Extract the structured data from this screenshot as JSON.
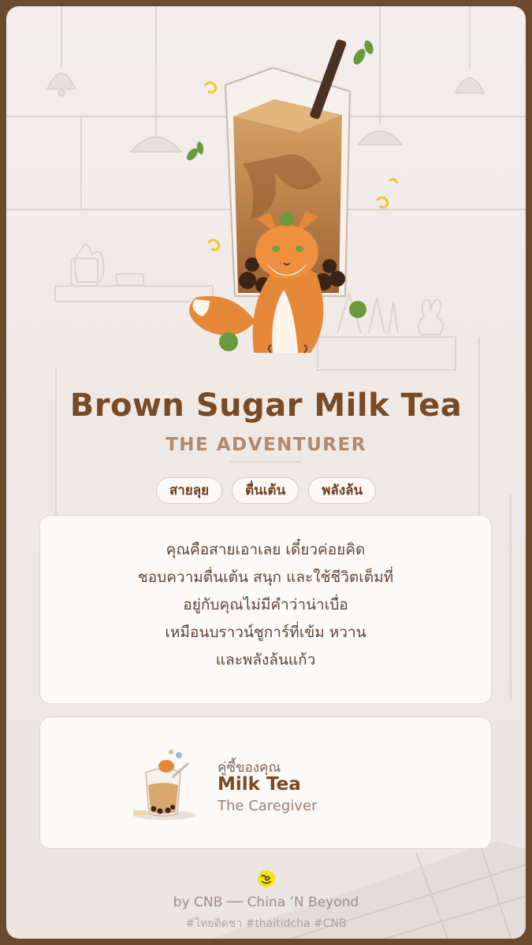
{
  "result": {
    "title": "Brown Sugar Milk Tea",
    "subtitle": "THE ADVENTURER",
    "tags": [
      "สายลุย",
      "ตื่นเต้น",
      "พลังล้น"
    ],
    "description_lines": [
      "คุณคือสายเอาเลย เดี๋ยวค่อยคิด",
      "ชอบความตื่นเต้น สนุก และใช้ชีวิตเต็มที่",
      "อยู่กับคุณไม่มีคำว่าน่าเบื่อ",
      "เหมือนบราวน์ชูการ์ที่เข้ม หวาน",
      "และพลังล้นแก้ว"
    ]
  },
  "partner": {
    "label": "คู่ซี้ของคุณ",
    "name": "Milk Tea",
    "role": "The Caregiver"
  },
  "footer": {
    "byline": "by CNB ── China ’N Beyond",
    "hashtags": "#ไทยติดชา #thaitidcha #CNB",
    "logo_icon": "cnb-smiley-logo-icon"
  },
  "colors": {
    "frame": "#6b4a2e",
    "title": "#7a4a25",
    "subtitle": "#b08a6c",
    "card_bg": "#f3eeec"
  }
}
